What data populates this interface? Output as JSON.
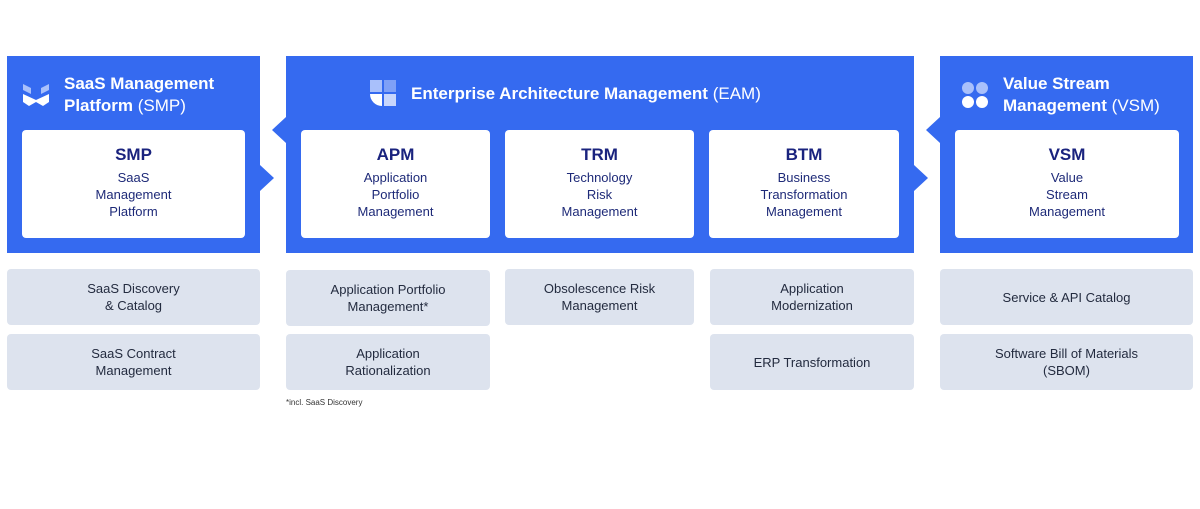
{
  "colors": {
    "accent": "#356af0",
    "card_text": "#1a237e",
    "gray_box": "#dde3ee"
  },
  "smp": {
    "header_bold_1": "SaaS Management",
    "header_bold_2": "Platform",
    "header_abbr": "(SMP)",
    "icon": "bookshelf-logo-icon",
    "card": {
      "title": "SMP",
      "lines": [
        "SaaS",
        "Management",
        "Platform"
      ]
    },
    "capabilities": [
      "SaaS Discovery\n& Catalog",
      "SaaS Contract\nManagement"
    ]
  },
  "eam": {
    "header_bold": "Enterprise Architecture Management",
    "header_abbr": "(EAM)",
    "icon": "quadrant-logo-icon",
    "cards": [
      {
        "title": "APM",
        "lines": [
          "Application",
          "Portfolio",
          "Management"
        ]
      },
      {
        "title": "TRM",
        "lines": [
          "Technology",
          "Risk",
          "Management"
        ]
      },
      {
        "title": "BTM",
        "lines": [
          "Business",
          "Transformation",
          "Management"
        ]
      }
    ],
    "capabilities": {
      "apm": [
        "Application Portfolio\nManagement*",
        "Application\nRationalization"
      ],
      "trm": [
        "Obsolescence Risk\nManagement"
      ],
      "btm": [
        "Application\nModernization",
        "ERP Transformation"
      ]
    },
    "footnote": "*incl. SaaS Discovery"
  },
  "vsm": {
    "header_bold_1": "Value Stream",
    "header_bold_2": "Management",
    "header_abbr": "(VSM)",
    "icon": "four-dots-logo-icon",
    "card": {
      "title": "VSM",
      "lines": [
        "Value",
        "Stream",
        "Management"
      ]
    },
    "capabilities": [
      "Service & API Catalog",
      "Software Bill of Materials\n(SBOM)"
    ]
  }
}
